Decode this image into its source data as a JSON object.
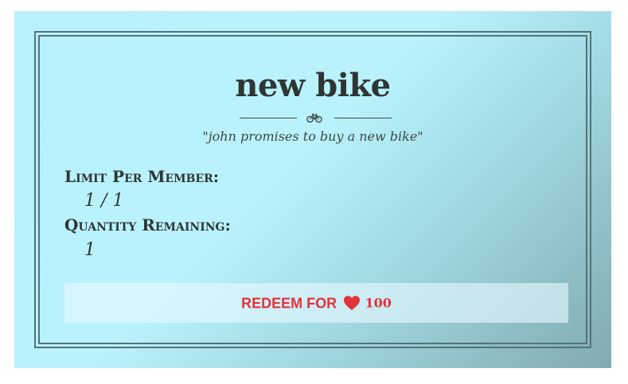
{
  "reward": {
    "title": "new bike",
    "description": "\"john promises to buy a new bike\"",
    "divider_icon": "bicycle-icon"
  },
  "details": {
    "limit_label": "Limit Per Member:",
    "limit_value": "1 / 1",
    "remaining_label": "Quantity Remaining:",
    "remaining_value": "1"
  },
  "redeem": {
    "label": "REDEEM FOR",
    "icon": "heart-icon",
    "cost": "100"
  },
  "colors": {
    "card_gradient_start": "#b8f1fb",
    "card_gradient_end": "#80aab0",
    "frame": "#54727a",
    "text": "#2f3533",
    "accent": "#e0333b"
  }
}
